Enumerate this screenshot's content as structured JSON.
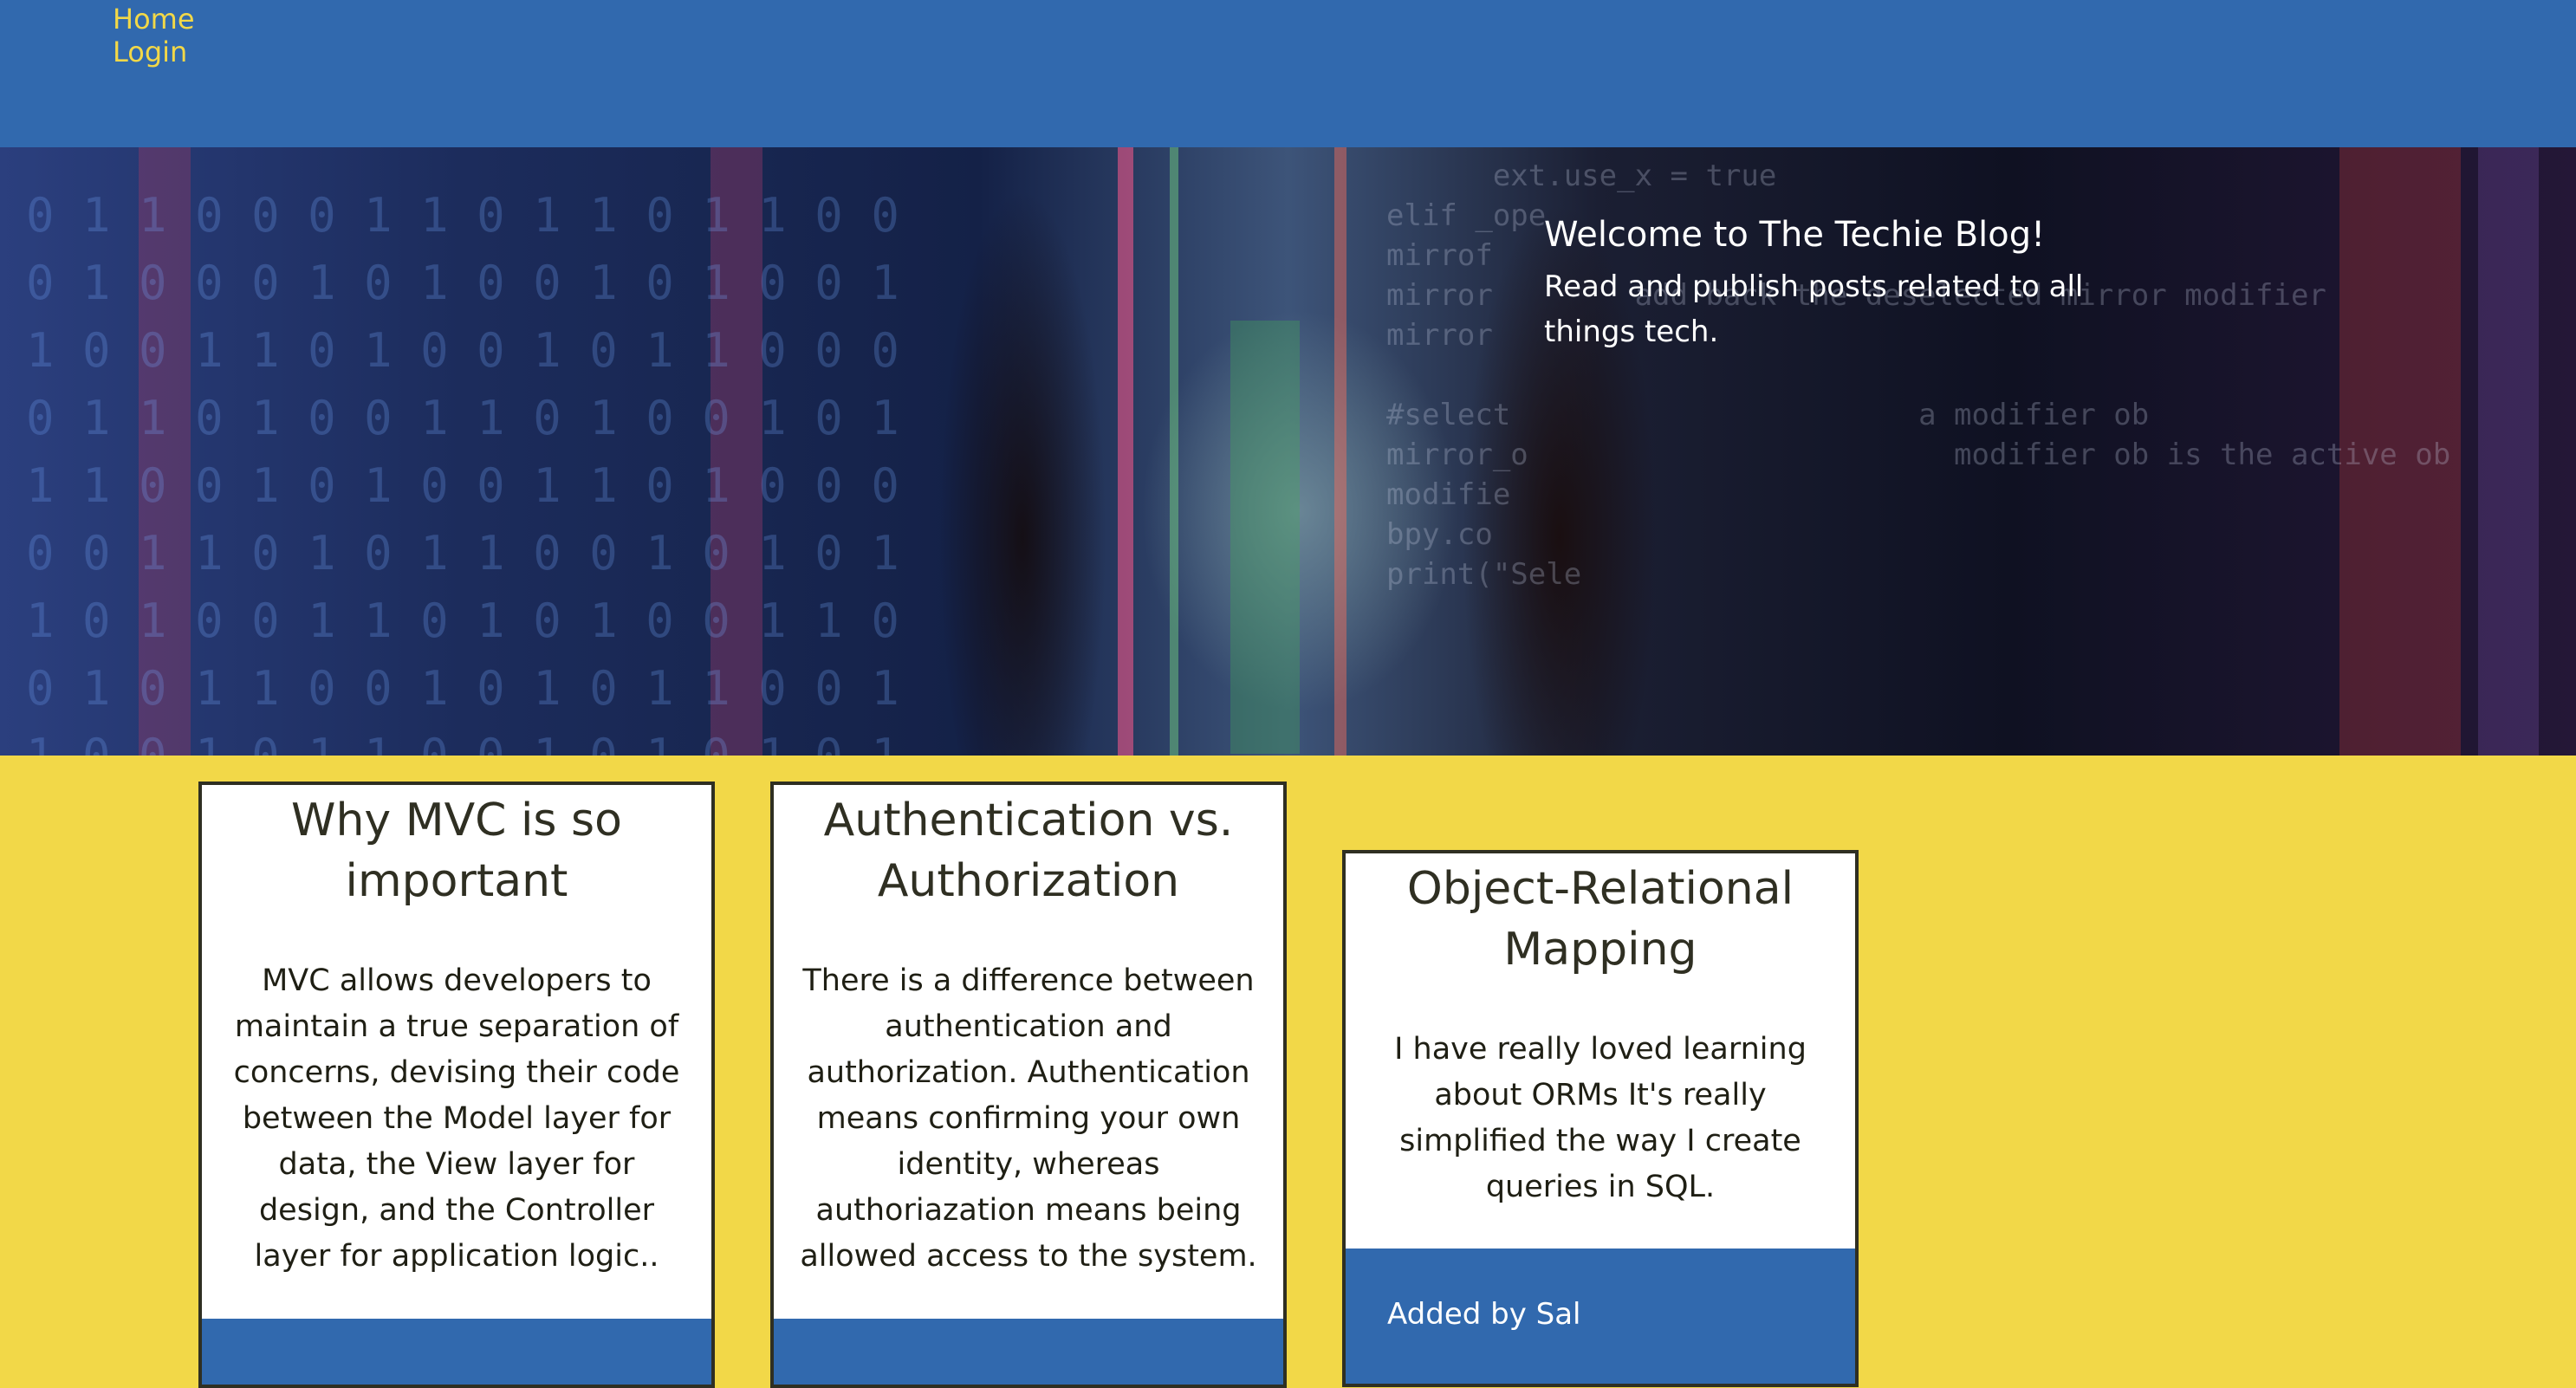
{
  "nav": {
    "home_label": "Home",
    "login_label": "Login",
    "background": "#3169ae",
    "link_color": "#f2d848"
  },
  "hero": {
    "title": "Welcome to The Techie Blog!",
    "subtitle": "Read and publish posts related to all things tech."
  },
  "posts": [
    {
      "title": "Why MVC is so important",
      "body": "MVC allows developers to maintain a true separation of concerns, devising their code between the Model layer for data, the View layer for design, and the Controller layer for application logic..",
      "author_line": ""
    },
    {
      "title": "Authentication vs. Authorization",
      "body": "There is a difference between authentication and authorization. Authentication means confirming your own identity, whereas authoriazation means being allowed access to the system.",
      "author_line": ""
    },
    {
      "title": "Object-Relational Mapping",
      "body": "I have really loved learning about ORMs It's really simplified the way I create queries in SQL.",
      "author_line": "Added by Sal"
    }
  ],
  "colors": {
    "page_background": "#f2d848",
    "card_background": "#ffffff",
    "card_border": "#2f2f22",
    "card_footer": "#3169ae"
  }
}
